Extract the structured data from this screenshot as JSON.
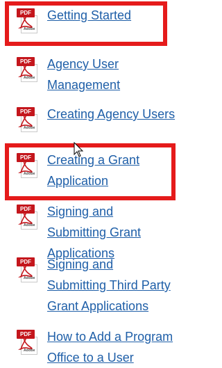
{
  "docs": [
    {
      "label": "Getting Started",
      "icon": "pdf-icon"
    },
    {
      "label": "Agency User Management",
      "icon": "pdf-icon"
    },
    {
      "label": "Creating Agency Users",
      "icon": "pdf-icon"
    },
    {
      "label": "Creating a Grant Application",
      "icon": "pdf-icon"
    },
    {
      "label": "Signing and Submitting Grant Applications",
      "icon": "pdf-icon"
    },
    {
      "label": "Signing and Submitting Third Party Grant Applications",
      "icon": "pdf-icon"
    },
    {
      "label": "How to Add a Program Office to a User",
      "icon": "pdf-icon"
    }
  ],
  "icon_text": {
    "pdf": "PDF",
    "adobe": "Adobe"
  },
  "colors": {
    "link": "#1f5fa8",
    "highlight": "#e51b1b",
    "pdf_red": "#c4161c"
  }
}
